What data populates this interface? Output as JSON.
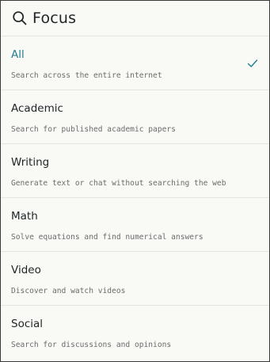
{
  "header": {
    "title": "Focus",
    "icon": "search-icon"
  },
  "accent_color": "#1f7f8f",
  "options": [
    {
      "label": "All",
      "description": "Search across the entire internet",
      "selected": true
    },
    {
      "label": "Academic",
      "description": "Search for published academic papers",
      "selected": false
    },
    {
      "label": "Writing",
      "description": "Generate text or chat without searching the web",
      "selected": false
    },
    {
      "label": "Math",
      "description": "Solve equations and find numerical answers",
      "selected": false
    },
    {
      "label": "Video",
      "description": "Discover and watch videos",
      "selected": false
    },
    {
      "label": "Social",
      "description": "Search for discussions and opinions",
      "selected": false
    }
  ]
}
